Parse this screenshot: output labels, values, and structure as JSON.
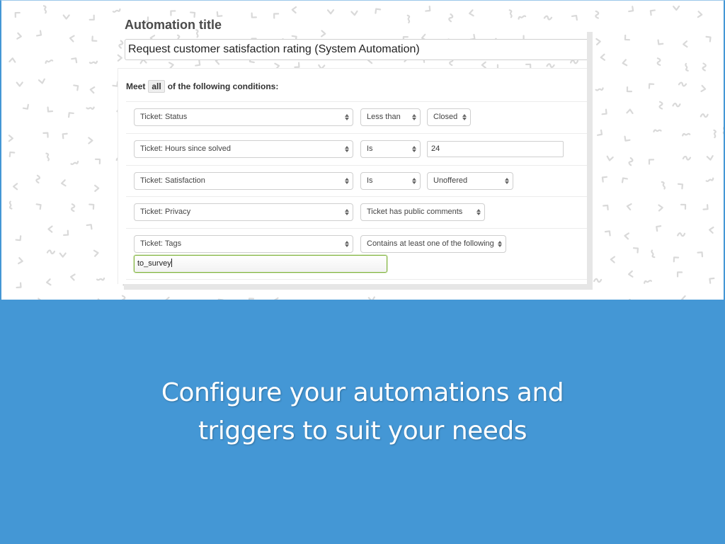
{
  "automation": {
    "title_label": "Automation title",
    "title_value": "Request customer satisfaction rating (System Automation)",
    "conditions_header": {
      "prefix": "Meet",
      "mode": "all",
      "suffix": "of the following conditions:"
    },
    "conditions": [
      {
        "field": "Ticket: Status",
        "operator": "Less than",
        "value": "Closed",
        "value_type": "select"
      },
      {
        "field": "Ticket: Hours since solved",
        "operator": "Is",
        "value": "24",
        "value_type": "text"
      },
      {
        "field": "Ticket: Satisfaction",
        "operator": "Is",
        "value": "Unoffered",
        "value_type": "select"
      },
      {
        "field": "Ticket: Privacy",
        "operator": "Ticket has public comments",
        "value_type": "none"
      },
      {
        "field": "Ticket: Tags",
        "operator": "Contains at least one of the following",
        "value": "to_survey",
        "value_type": "tags"
      }
    ]
  },
  "caption": {
    "line1": "Configure your automations and",
    "line2": "triggers to suit your needs"
  },
  "colors": {
    "banner_blue": "#4497d5",
    "focus_green": "#7fb33a"
  }
}
